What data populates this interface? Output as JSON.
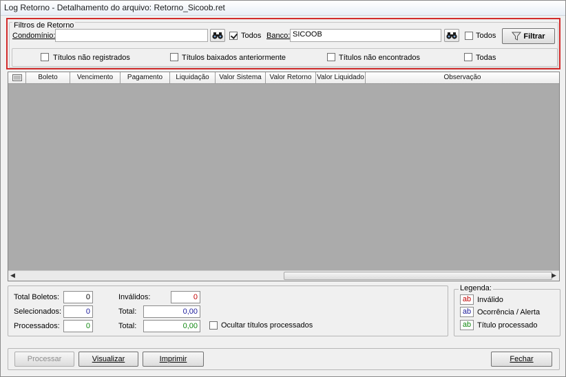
{
  "window": {
    "title": "Log Retorno - Detalhamento do arquivo: Retorno_Sicoob.ret"
  },
  "filters": {
    "group_label": "Filtros de Retorno",
    "condominio_label": "Condomínio:",
    "condominio_value": "",
    "todos_condominio_label": "Todos",
    "todos_condominio_checked": true,
    "banco_label": "Banco:",
    "banco_value": "SICOOB",
    "todos_banco_label": "Todos",
    "todos_banco_checked": false,
    "filtrar_label": "Filtrar",
    "options": [
      {
        "label": "Títulos não registrados",
        "checked": false
      },
      {
        "label": "Títulos baixados anteriormente",
        "checked": false
      },
      {
        "label": "Títulos não encontrados",
        "checked": false
      },
      {
        "label": "Todas",
        "checked": false
      }
    ]
  },
  "grid": {
    "columns": [
      "Boleto",
      "Vencimento",
      "Pagamento",
      "Liquidação",
      "Valor Sistema",
      "Valor Retorno",
      "Valor Liquidado",
      "Observação"
    ]
  },
  "stats": {
    "total_boletos_label": "Total Boletos:",
    "total_boletos_value": "0",
    "selecionados_label": "Selecionados:",
    "selecionados_value": "0",
    "processados_label": "Processados:",
    "processados_value": "0",
    "invalidos_label": "Inválidos:",
    "invalidos_value": "0",
    "total1_label": "Total:",
    "total1_value": "0,00",
    "total2_label": "Total:",
    "total2_value": "0,00",
    "ocultar_label": "Ocultar títulos processados",
    "ocultar_checked": false
  },
  "legend": {
    "title": "Legenda:",
    "items": [
      {
        "sample": "ab",
        "label": "Inválido",
        "color": "#c00000"
      },
      {
        "sample": "ab",
        "label": "Ocorrência / Alerta",
        "color": "#1a1a9a"
      },
      {
        "sample": "ab",
        "label": "Título processado",
        "color": "#118811"
      }
    ]
  },
  "footer": {
    "processar_label": "Processar",
    "visualizar_label": "Visualizar",
    "imprimir_label": "Imprimir",
    "fechar_label": "Fechar"
  },
  "colors": {
    "highlight_frame": "#d22a2a",
    "invalid_text": "#c00000",
    "neutral_text": "#1a1a9a",
    "processed_text": "#118811"
  }
}
